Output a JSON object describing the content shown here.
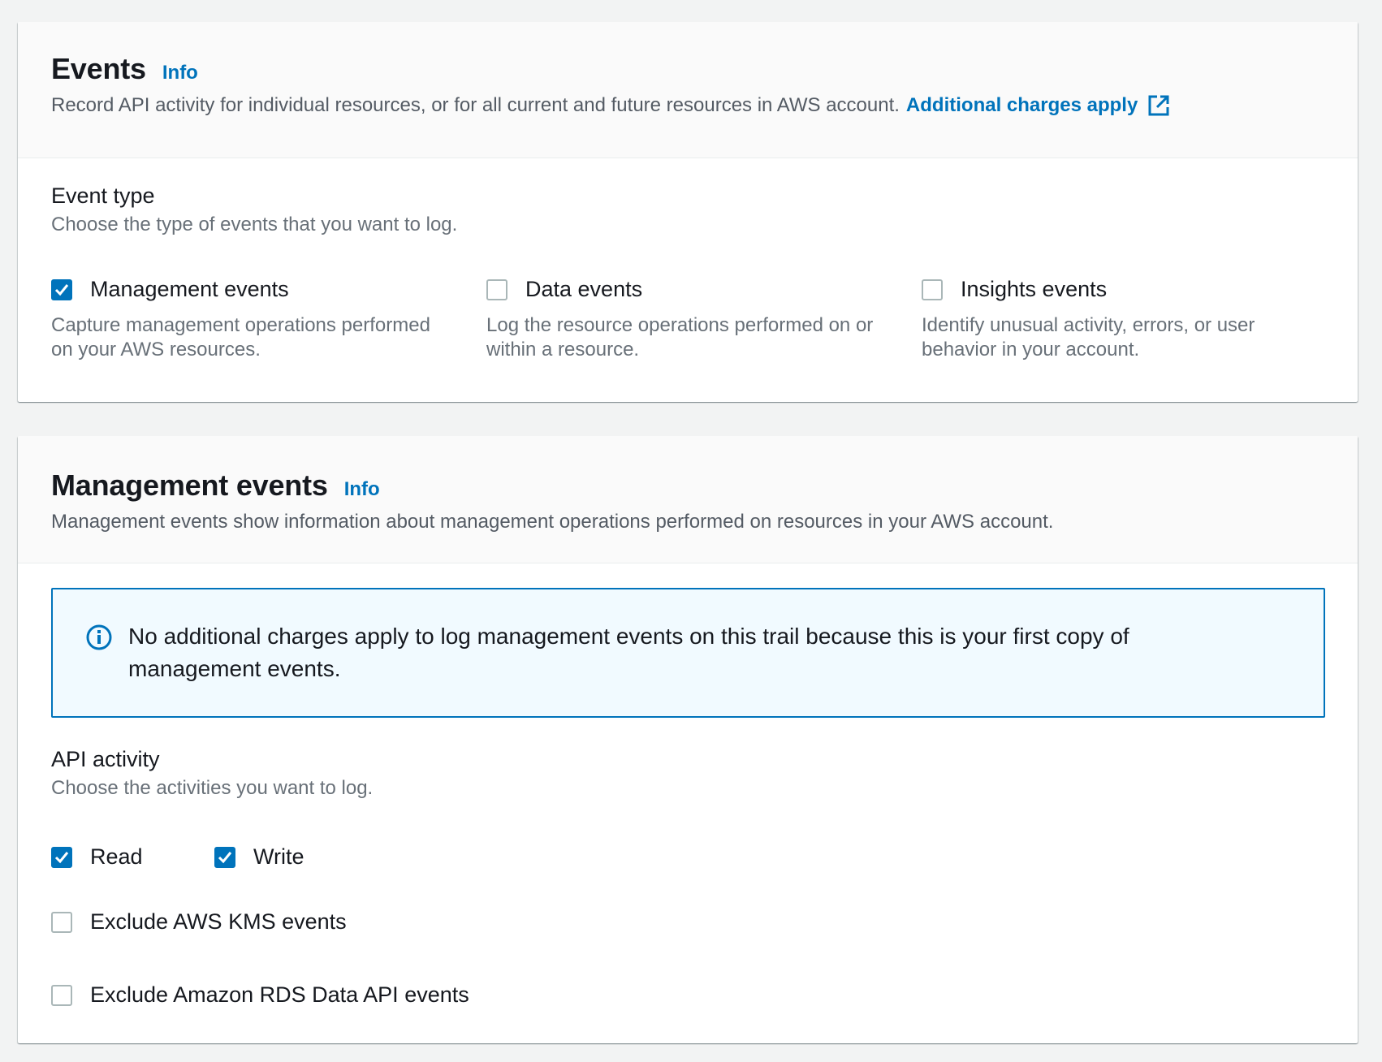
{
  "events_panel": {
    "title": "Events",
    "info": "Info",
    "description": "Record API activity for individual resources, or for all current and future resources in AWS account.",
    "charges_link": "Additional charges apply",
    "event_type": {
      "label": "Event type",
      "sublabel": "Choose the type of events that you want to log.",
      "options": [
        {
          "label": "Management events",
          "checked": true,
          "description": "Capture management operations performed on your AWS resources."
        },
        {
          "label": "Data events",
          "checked": false,
          "description": "Log the resource operations performed on or within a resource."
        },
        {
          "label": "Insights events",
          "checked": false,
          "description": "Identify unusual activity, errors, or user behavior in your account."
        }
      ]
    }
  },
  "management_panel": {
    "title": "Management events",
    "info": "Info",
    "description": "Management events show information about management operations performed on resources in your AWS account.",
    "alert": "No additional charges apply to log management events on this trail because this is your first copy of management events.",
    "api_activity": {
      "label": "API activity",
      "sublabel": "Choose the activities you want to log.",
      "read": {
        "label": "Read",
        "checked": true
      },
      "write": {
        "label": "Write",
        "checked": true
      }
    },
    "exclude_kms": {
      "label": "Exclude AWS KMS events",
      "checked": false
    },
    "exclude_rds": {
      "label": "Exclude Amazon RDS Data API events",
      "checked": false
    }
  },
  "colors": {
    "link": "#0073bb",
    "checkbox_checked": "#0073bb",
    "alert_bg": "#f1faff",
    "page_bg": "#f2f3f3"
  }
}
